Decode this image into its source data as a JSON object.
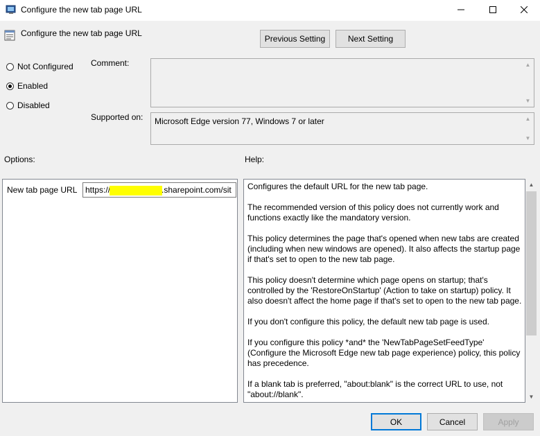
{
  "window": {
    "title": "Configure the new tab page URL",
    "minimize_icon": "minimize-icon",
    "maximize_icon": "maximize-icon",
    "close_icon": "close-icon"
  },
  "header": {
    "policy_title": "Configure the new tab page URL",
    "previous_label": "Previous Setting",
    "next_label": "Next Setting"
  },
  "state": {
    "options": [
      {
        "label": "Not Configured",
        "checked": false
      },
      {
        "label": "Enabled",
        "checked": true
      },
      {
        "label": "Disabled",
        "checked": false
      }
    ]
  },
  "comment": {
    "label": "Comment:",
    "value": ""
  },
  "supported": {
    "label": "Supported on:",
    "value": "Microsoft Edge version 77, Windows 7 or later"
  },
  "options_panel": {
    "label": "Options:",
    "field_label": "New tab page URL",
    "url_prefix": "https://",
    "url_suffix": ".sharepoint.com/sit"
  },
  "help_panel": {
    "label": "Help:",
    "paragraphs": [
      "Configures the default URL for the new tab page.",
      "The recommended version of this policy does not currently work and functions exactly like the mandatory version.",
      "This policy determines the page that's opened when new tabs are created (including when new windows are opened). It also affects the startup page if that's set to open to the new tab page.",
      "This policy doesn't determine which page opens on startup; that's controlled by the 'RestoreOnStartup' (Action to take on startup) policy. It also doesn't affect the home page if that's set to open to the new tab page.",
      "If you don't configure this policy, the default new tab page is used.",
      "If you configure this policy *and* the 'NewTabPageSetFeedType' (Configure the Microsoft Edge new tab page experience) policy, this policy has precedence.",
      "If a blank tab is preferred, \"about:blank\" is the correct URL to use, not \"about://blank\"."
    ]
  },
  "footer": {
    "ok_label": "OK",
    "cancel_label": "Cancel",
    "apply_label": "Apply"
  }
}
